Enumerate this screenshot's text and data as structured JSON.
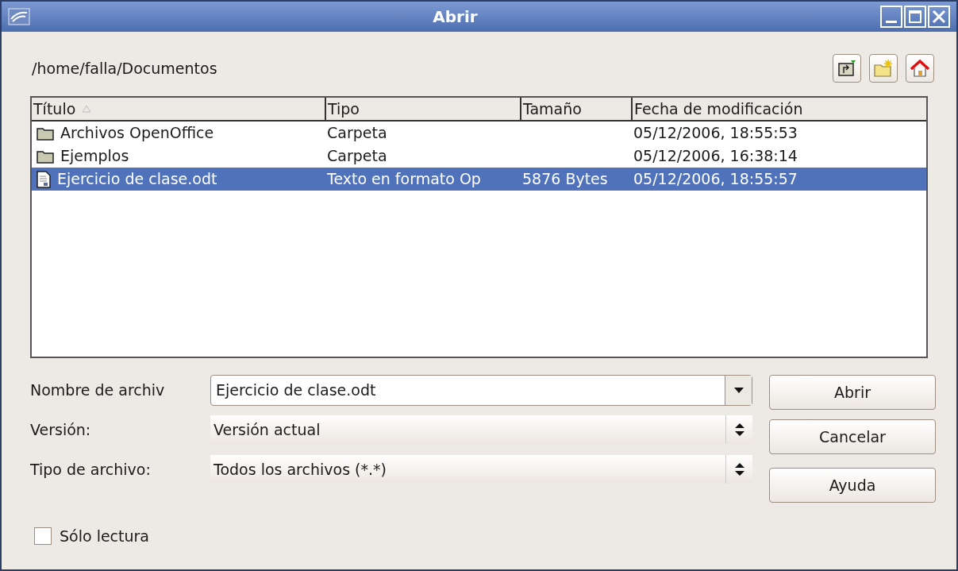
{
  "window": {
    "title": "Abrir"
  },
  "path": "/home/falla/Documentos",
  "table": {
    "columns": [
      "Título",
      "Tipo",
      "Tamaño",
      "Fecha de modificación"
    ],
    "rows": [
      {
        "kind": "folder",
        "selected": false,
        "cells": [
          "Archivos OpenOffice",
          "Carpeta",
          "",
          "05/12/2006, 18:55:53"
        ]
      },
      {
        "kind": "folder",
        "selected": false,
        "cells": [
          "Ejemplos",
          "Carpeta",
          "",
          "05/12/2006, 16:38:14"
        ]
      },
      {
        "kind": "file",
        "selected": true,
        "cells": [
          "Ejercicio de clase.odt",
          "Texto en formato Op",
          "5876 Bytes",
          "05/12/2006, 18:55:57"
        ]
      }
    ]
  },
  "fields": [
    {
      "kind": "combo",
      "label": "Nombre de archiv",
      "value": "Ejercicio de clase.odt"
    },
    {
      "kind": "select",
      "label": "Versión:",
      "value": "Versión actual"
    },
    {
      "kind": "select",
      "label": "Tipo de archivo:",
      "value": "Todos los archivos (*.*)"
    }
  ],
  "buttons": [
    "Abrir",
    "Cancelar",
    "Ayuda"
  ],
  "read_only": {
    "label": "Sólo lectura",
    "checked": false
  }
}
